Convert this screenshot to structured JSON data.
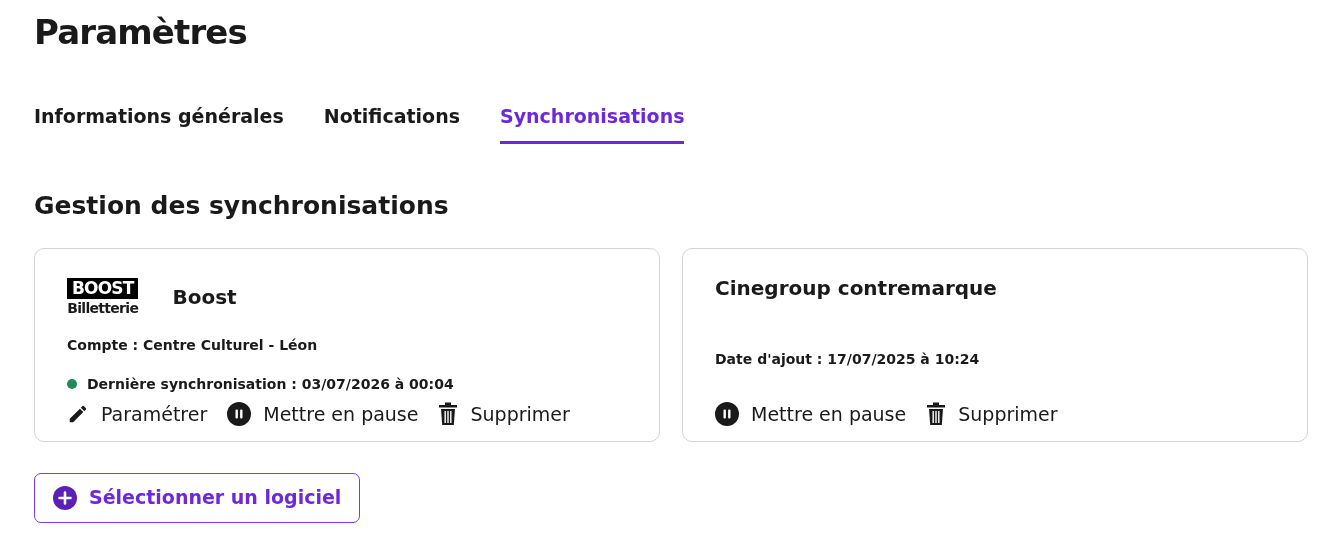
{
  "title": "Paramètres",
  "tabs": [
    {
      "label": "Informations générales",
      "selected": false
    },
    {
      "label": "Notifications",
      "selected": false
    },
    {
      "label": "Synchronisations",
      "selected": true
    }
  ],
  "section_title": "Gestion des synchronisations",
  "cards": [
    {
      "logo": {
        "line_1": "BOOST",
        "line_2": "Billetterie"
      },
      "name": "Boost",
      "details": [
        {
          "text": "Compte : Centre Culturel - Léon"
        },
        {
          "text": "Dernière synchronisation : 03/07/2026 à 00:04",
          "color": "#1f8a5a"
        }
      ],
      "actions": [
        {
          "kind": "configure",
          "label": "Paramétrer"
        },
        {
          "kind": "pause",
          "label": "Mettre en pause"
        },
        {
          "kind": "delete",
          "label": "Supprimer"
        }
      ]
    },
    {
      "name": "Cinegroup contremarque",
      "details": [
        {
          "text": "Date d'ajout : 17/07/2025 à 10:24"
        }
      ],
      "actions": [
        {
          "kind": "pause",
          "label": "Mettre en pause"
        },
        {
          "kind": "delete",
          "label": "Supprimer"
        }
      ]
    }
  ],
  "add_button": "Sélectionner un logiciel"
}
